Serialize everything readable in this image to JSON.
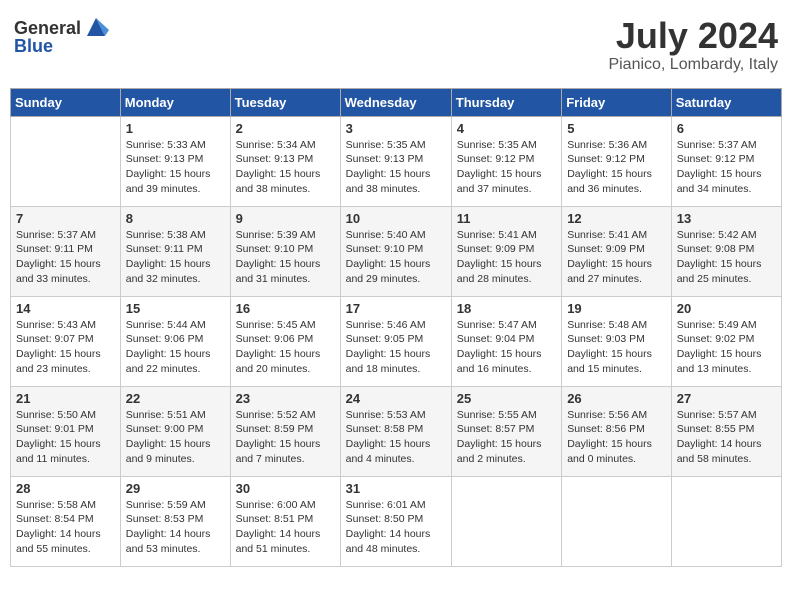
{
  "header": {
    "logo_general": "General",
    "logo_blue": "Blue",
    "month_year": "July 2024",
    "location": "Pianico, Lombardy, Italy"
  },
  "columns": [
    "Sunday",
    "Monday",
    "Tuesday",
    "Wednesday",
    "Thursday",
    "Friday",
    "Saturday"
  ],
  "weeks": [
    {
      "days": [
        {
          "num": "",
          "info": ""
        },
        {
          "num": "1",
          "info": "Sunrise: 5:33 AM\nSunset: 9:13 PM\nDaylight: 15 hours\nand 39 minutes."
        },
        {
          "num": "2",
          "info": "Sunrise: 5:34 AM\nSunset: 9:13 PM\nDaylight: 15 hours\nand 38 minutes."
        },
        {
          "num": "3",
          "info": "Sunrise: 5:35 AM\nSunset: 9:13 PM\nDaylight: 15 hours\nand 38 minutes."
        },
        {
          "num": "4",
          "info": "Sunrise: 5:35 AM\nSunset: 9:12 PM\nDaylight: 15 hours\nand 37 minutes."
        },
        {
          "num": "5",
          "info": "Sunrise: 5:36 AM\nSunset: 9:12 PM\nDaylight: 15 hours\nand 36 minutes."
        },
        {
          "num": "6",
          "info": "Sunrise: 5:37 AM\nSunset: 9:12 PM\nDaylight: 15 hours\nand 34 minutes."
        }
      ]
    },
    {
      "days": [
        {
          "num": "7",
          "info": "Sunrise: 5:37 AM\nSunset: 9:11 PM\nDaylight: 15 hours\nand 33 minutes."
        },
        {
          "num": "8",
          "info": "Sunrise: 5:38 AM\nSunset: 9:11 PM\nDaylight: 15 hours\nand 32 minutes."
        },
        {
          "num": "9",
          "info": "Sunrise: 5:39 AM\nSunset: 9:10 PM\nDaylight: 15 hours\nand 31 minutes."
        },
        {
          "num": "10",
          "info": "Sunrise: 5:40 AM\nSunset: 9:10 PM\nDaylight: 15 hours\nand 29 minutes."
        },
        {
          "num": "11",
          "info": "Sunrise: 5:41 AM\nSunset: 9:09 PM\nDaylight: 15 hours\nand 28 minutes."
        },
        {
          "num": "12",
          "info": "Sunrise: 5:41 AM\nSunset: 9:09 PM\nDaylight: 15 hours\nand 27 minutes."
        },
        {
          "num": "13",
          "info": "Sunrise: 5:42 AM\nSunset: 9:08 PM\nDaylight: 15 hours\nand 25 minutes."
        }
      ]
    },
    {
      "days": [
        {
          "num": "14",
          "info": "Sunrise: 5:43 AM\nSunset: 9:07 PM\nDaylight: 15 hours\nand 23 minutes."
        },
        {
          "num": "15",
          "info": "Sunrise: 5:44 AM\nSunset: 9:06 PM\nDaylight: 15 hours\nand 22 minutes."
        },
        {
          "num": "16",
          "info": "Sunrise: 5:45 AM\nSunset: 9:06 PM\nDaylight: 15 hours\nand 20 minutes."
        },
        {
          "num": "17",
          "info": "Sunrise: 5:46 AM\nSunset: 9:05 PM\nDaylight: 15 hours\nand 18 minutes."
        },
        {
          "num": "18",
          "info": "Sunrise: 5:47 AM\nSunset: 9:04 PM\nDaylight: 15 hours\nand 16 minutes."
        },
        {
          "num": "19",
          "info": "Sunrise: 5:48 AM\nSunset: 9:03 PM\nDaylight: 15 hours\nand 15 minutes."
        },
        {
          "num": "20",
          "info": "Sunrise: 5:49 AM\nSunset: 9:02 PM\nDaylight: 15 hours\nand 13 minutes."
        }
      ]
    },
    {
      "days": [
        {
          "num": "21",
          "info": "Sunrise: 5:50 AM\nSunset: 9:01 PM\nDaylight: 15 hours\nand 11 minutes."
        },
        {
          "num": "22",
          "info": "Sunrise: 5:51 AM\nSunset: 9:00 PM\nDaylight: 15 hours\nand 9 minutes."
        },
        {
          "num": "23",
          "info": "Sunrise: 5:52 AM\nSunset: 8:59 PM\nDaylight: 15 hours\nand 7 minutes."
        },
        {
          "num": "24",
          "info": "Sunrise: 5:53 AM\nSunset: 8:58 PM\nDaylight: 15 hours\nand 4 minutes."
        },
        {
          "num": "25",
          "info": "Sunrise: 5:55 AM\nSunset: 8:57 PM\nDaylight: 15 hours\nand 2 minutes."
        },
        {
          "num": "26",
          "info": "Sunrise: 5:56 AM\nSunset: 8:56 PM\nDaylight: 15 hours\nand 0 minutes."
        },
        {
          "num": "27",
          "info": "Sunrise: 5:57 AM\nSunset: 8:55 PM\nDaylight: 14 hours\nand 58 minutes."
        }
      ]
    },
    {
      "days": [
        {
          "num": "28",
          "info": "Sunrise: 5:58 AM\nSunset: 8:54 PM\nDaylight: 14 hours\nand 55 minutes."
        },
        {
          "num": "29",
          "info": "Sunrise: 5:59 AM\nSunset: 8:53 PM\nDaylight: 14 hours\nand 53 minutes."
        },
        {
          "num": "30",
          "info": "Sunrise: 6:00 AM\nSunset: 8:51 PM\nDaylight: 14 hours\nand 51 minutes."
        },
        {
          "num": "31",
          "info": "Sunrise: 6:01 AM\nSunset: 8:50 PM\nDaylight: 14 hours\nand 48 minutes."
        },
        {
          "num": "",
          "info": ""
        },
        {
          "num": "",
          "info": ""
        },
        {
          "num": "",
          "info": ""
        }
      ]
    }
  ]
}
